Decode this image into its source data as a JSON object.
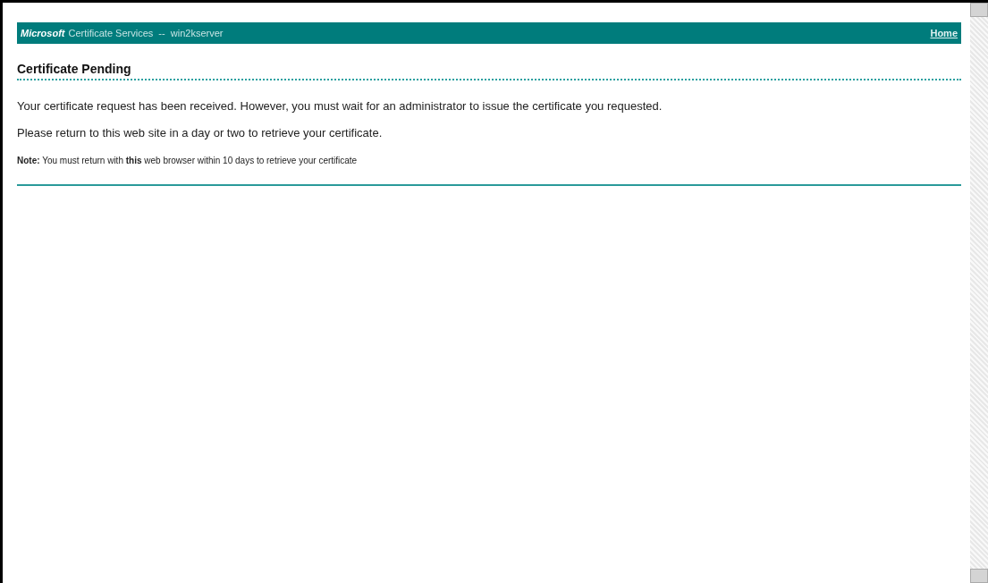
{
  "banner": {
    "brand": "Microsoft",
    "title": "Certificate Services  --  win2kserver",
    "home_link": "Home"
  },
  "heading": "Certificate Pending",
  "paragraphs": [
    "Your certificate request has been received. However, you must wait for an administrator to issue the certificate you requested.",
    "Please return to this web site in a day or two to retrieve your certificate."
  ],
  "note": "**Note:** You must return with **this** web browser within 10 days to retrieve your certificate"
}
